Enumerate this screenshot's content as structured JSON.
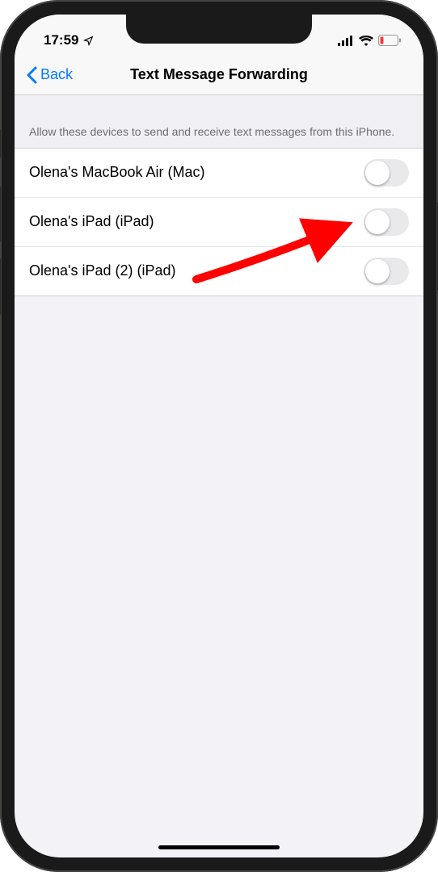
{
  "status_bar": {
    "time": "17:59"
  },
  "nav": {
    "back_label": "Back",
    "title": "Text Message Forwarding"
  },
  "section_header": "Allow these devices to send and receive text messages from this iPhone.",
  "devices": [
    {
      "label": "Olena's MacBook Air (Mac)",
      "enabled": false
    },
    {
      "label": "Olena's iPad (iPad)",
      "enabled": false
    },
    {
      "label": "Olena's iPad (2) (iPad)",
      "enabled": false
    }
  ],
  "annotation": {
    "arrow_color": "#ff0000"
  }
}
